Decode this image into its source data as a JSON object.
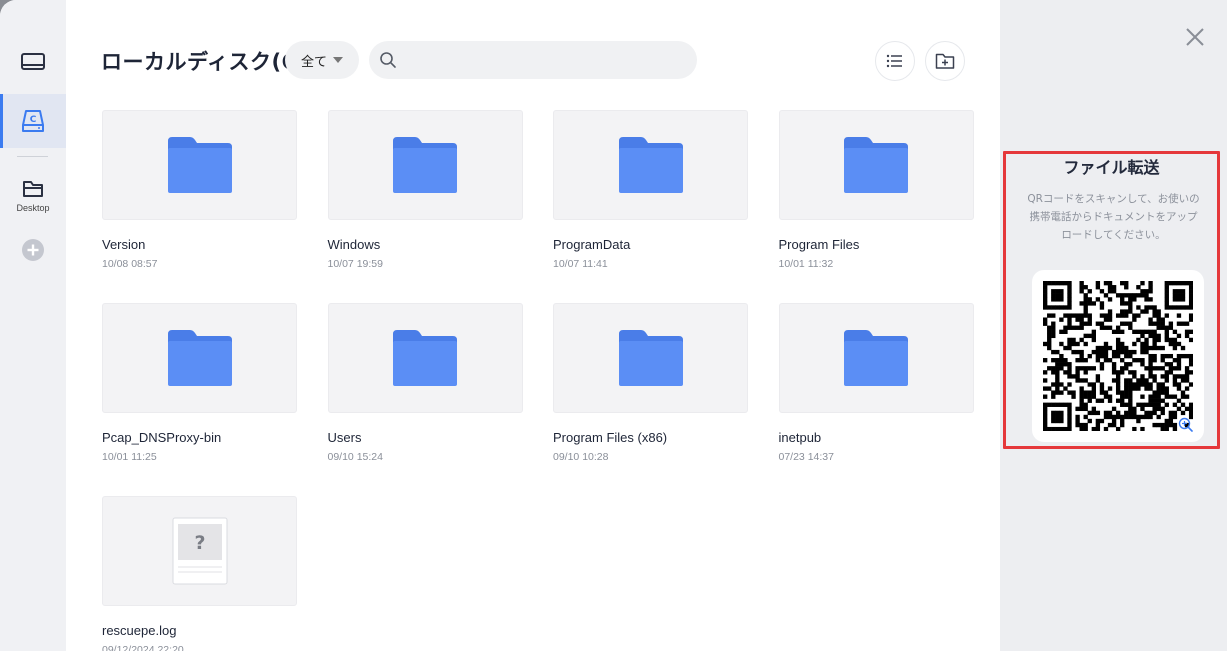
{
  "header": {
    "title": "ローカルディスク(C)",
    "filter_label": "全て",
    "search_placeholder": ""
  },
  "rail": {
    "items": [
      {
        "icon": "monitor-icon"
      },
      {
        "icon": "disk-c-icon",
        "glyph": "C",
        "active": true
      },
      {
        "icon": "folder-icon",
        "label": "Desktop"
      },
      {
        "icon": "add-icon"
      }
    ]
  },
  "files": [
    {
      "name": "Version",
      "date": "10/08 08:57",
      "type": "folder"
    },
    {
      "name": "Windows",
      "date": "10/07 19:59",
      "type": "folder"
    },
    {
      "name": "ProgramData",
      "date": "10/07 11:41",
      "type": "folder"
    },
    {
      "name": "Program Files",
      "date": "10/01 11:32",
      "type": "folder"
    },
    {
      "name": "Pcap_DNSProxy-bin",
      "date": "10/01 11:25",
      "type": "folder"
    },
    {
      "name": "Users",
      "date": "09/10 15:24",
      "type": "folder"
    },
    {
      "name": "Program Files (x86)",
      "date": "09/10 10:28",
      "type": "folder"
    },
    {
      "name": "inetpub",
      "date": "07/23 14:37",
      "type": "folder"
    },
    {
      "name": "rescuepe.log",
      "date": "09/12/2024 22:20",
      "type": "unknown",
      "glyph": "?"
    }
  ],
  "transfer": {
    "title": "ファイル転送",
    "description": "QRコードをスキャンして、お使いの携帯電話からドキュメントをアップロードしてください。"
  },
  "colors": {
    "folder": "#5b8ef5",
    "folder_tab": "#4a7de8",
    "accent": "#3b7bf0",
    "highlight": "#e5383b"
  }
}
